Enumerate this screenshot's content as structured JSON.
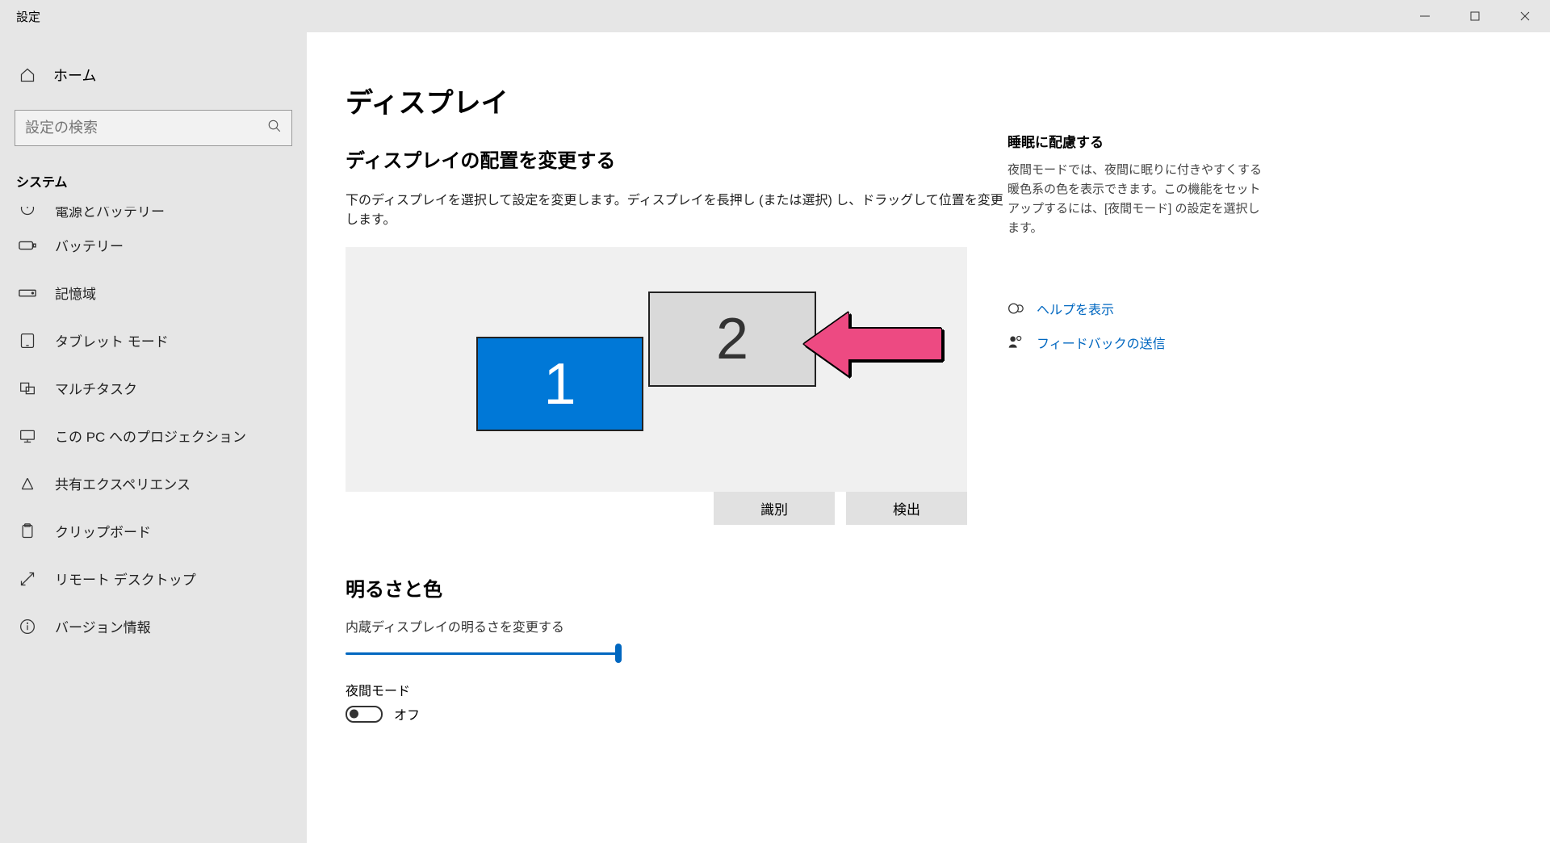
{
  "window": {
    "title": "設定"
  },
  "sidebar": {
    "home_label": "ホーム",
    "search_placeholder": "設定の検索",
    "section_label": "システム",
    "items": [
      {
        "label": "電源とバッテリー"
      },
      {
        "label": "バッテリー"
      },
      {
        "label": "記憶域"
      },
      {
        "label": "タブレット モード"
      },
      {
        "label": "マルチタスク"
      },
      {
        "label": "この PC へのプロジェクション"
      },
      {
        "label": "共有エクスペリエンス"
      },
      {
        "label": "クリップボード"
      },
      {
        "label": "リモート デスクトップ"
      },
      {
        "label": "バージョン情報"
      }
    ]
  },
  "main": {
    "page_title": "ディスプレイ",
    "arrange_title": "ディスプレイの配置を変更する",
    "arrange_desc": "下のディスプレイを選択して設定を変更します。ディスプレイを長押し (または選択) し、ドラッグして位置を変更します。",
    "monitor1": "1",
    "monitor2": "2",
    "identify_button": "識別",
    "detect_button": "検出",
    "brightness_title": "明るさと色",
    "brightness_slider_label": "内蔵ディスプレイの明るさを変更する",
    "night_mode_label": "夜間モード",
    "night_mode_state": "オフ"
  },
  "right": {
    "sleep_title": "睡眠に配慮する",
    "sleep_desc": "夜間モードでは、夜間に眠りに付きやすくする暖色系の色を表示できます。この機能をセットアップするには、[夜間モード] の設定を選択します。",
    "help_link": "ヘルプを表示",
    "feedback_link": "フィードバックの送信"
  }
}
